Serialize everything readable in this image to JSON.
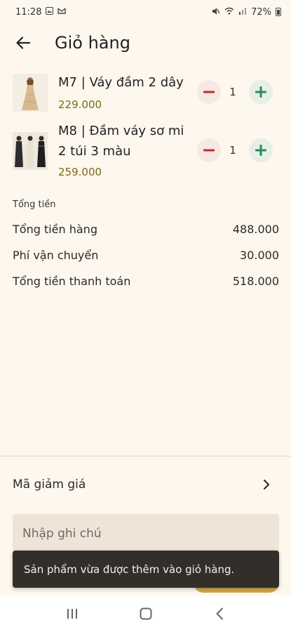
{
  "status_bar": {
    "time": "11:28",
    "battery": "72%",
    "icons_left": [
      "gallery-icon",
      "pinned-icon"
    ],
    "icons_right": [
      "mute-icon",
      "wifi-icon",
      "signal-icon",
      "battery-icon"
    ]
  },
  "header": {
    "title": "Giỏ hàng",
    "back_icon": "arrow-left-icon"
  },
  "cart": {
    "items": [
      {
        "name_line1": "M7 | Váy đầm 2 dây",
        "name_line2": "",
        "price": "229.000",
        "quantity": "1"
      },
      {
        "name_line1": "M8 | Đầm váy sơ mi",
        "name_line2": "2 túi 3 màu",
        "price": "259.000",
        "quantity": "1"
      }
    ]
  },
  "summary": {
    "heading": "Tổng tiền",
    "rows": [
      {
        "label": "Tổng tiền hàng",
        "value": "488.000"
      },
      {
        "label": "Phí vận chuyển",
        "value": "30.000"
      },
      {
        "label": "Tổng tiền thanh toán",
        "value": "518.000"
      }
    ]
  },
  "discount": {
    "label": "Mã giảm giá",
    "icon": "chevron-right-icon"
  },
  "note": {
    "placeholder": "Nhập ghi chú",
    "value": ""
  },
  "snackbar": {
    "message": "Sản phẩm vừa được thêm vào giỏ hàng."
  },
  "colors": {
    "background": "#fdf7ee",
    "price": "#7a6a14",
    "minus": "#c62828",
    "plus": "#2e8b57",
    "snackbar": "#322f2b"
  },
  "nav": {
    "buttons": [
      "recents-icon",
      "home-icon",
      "back-icon"
    ]
  }
}
